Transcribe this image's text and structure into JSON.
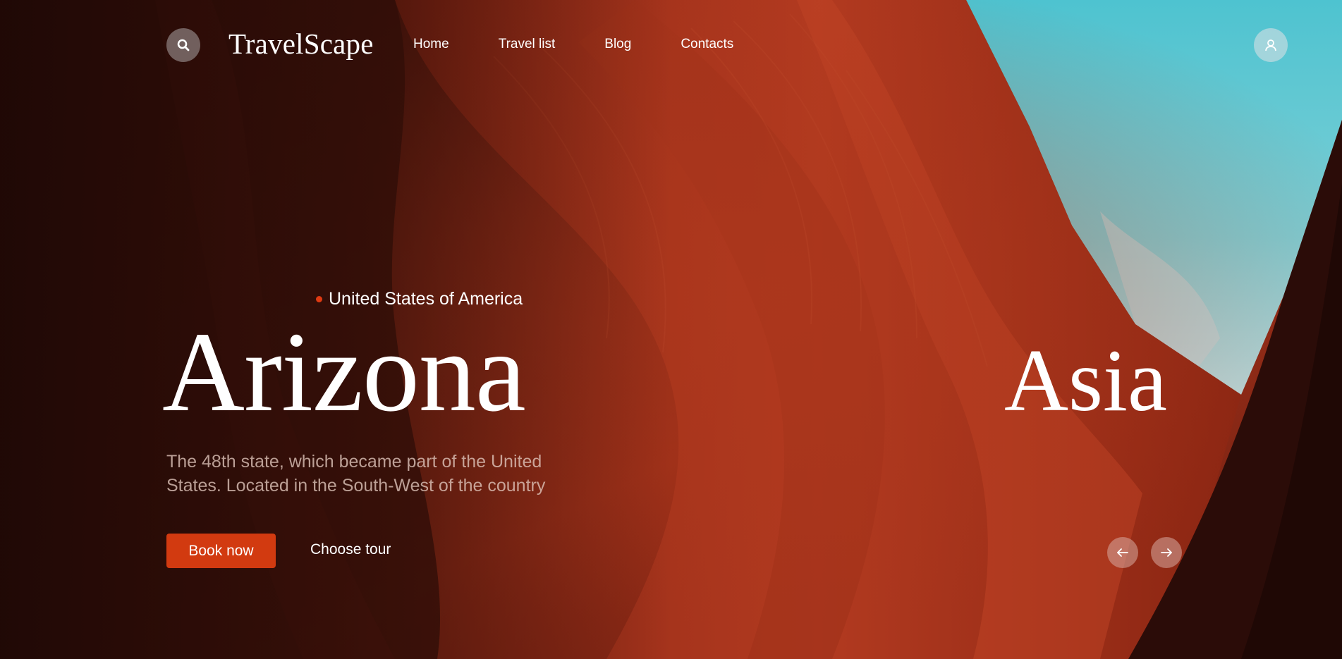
{
  "header": {
    "logo": "TravelScape",
    "search_icon": "search-icon",
    "user_icon": "user-icon",
    "nav": [
      {
        "label": "Home"
      },
      {
        "label": "Travel list"
      },
      {
        "label": "Blog"
      },
      {
        "label": "Contacts"
      }
    ]
  },
  "slide": {
    "country": "United States of America",
    "title": "Arizona",
    "description": "The 48th state, which became part of the United States. Located in the South-West of the country",
    "book_label": "Book now",
    "choose_label": "Choose tour"
  },
  "next_slide": {
    "title": "Asia"
  },
  "controls": {
    "prev_icon": "arrow-left-icon",
    "next_icon": "arrow-right-icon"
  },
  "colors": {
    "accent": "#d23a10",
    "dot": "#e03a12",
    "sky": "#5cc4d2",
    "rock": "#8a2312"
  }
}
